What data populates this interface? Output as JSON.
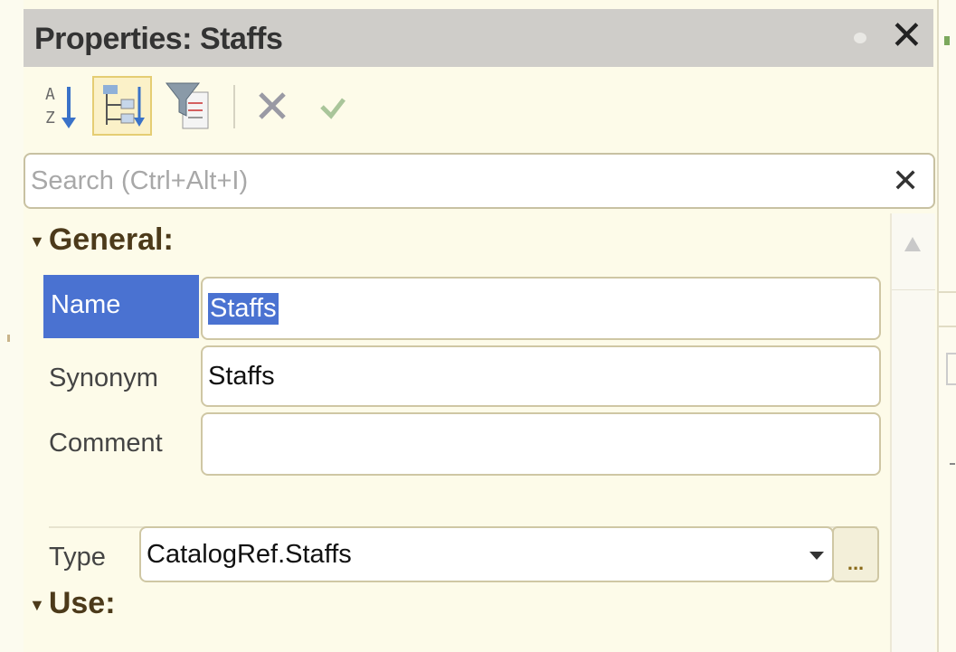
{
  "panel": {
    "title": "Properties: Staffs"
  },
  "toolbar": {
    "buttons": [
      {
        "icon": "sort-alphabetical-icon",
        "active": false
      },
      {
        "icon": "categorized-view-icon",
        "active": true
      },
      {
        "icon": "filter-icon",
        "active": false
      },
      {
        "icon": "delete-icon",
        "active": false
      },
      {
        "icon": "confirm-check-icon",
        "active": false
      }
    ]
  },
  "search": {
    "placeholder": "Search (Ctrl+Alt+I)",
    "value": ""
  },
  "groups": {
    "general": {
      "label": "General:"
    },
    "use": {
      "label": "Use:"
    }
  },
  "properties": {
    "name": {
      "label": "Name",
      "value": "Staffs"
    },
    "synonym": {
      "label": "Synonym",
      "value": "Staffs"
    },
    "comment": {
      "label": "Comment",
      "value": ""
    },
    "type": {
      "label": "Type",
      "value": "CatalogRef.Staffs",
      "more_label": "..."
    }
  },
  "colors": {
    "selection": "#4a72d1",
    "titlebar": "#cfcdc9",
    "panel_bg": "#fdfbe9"
  }
}
